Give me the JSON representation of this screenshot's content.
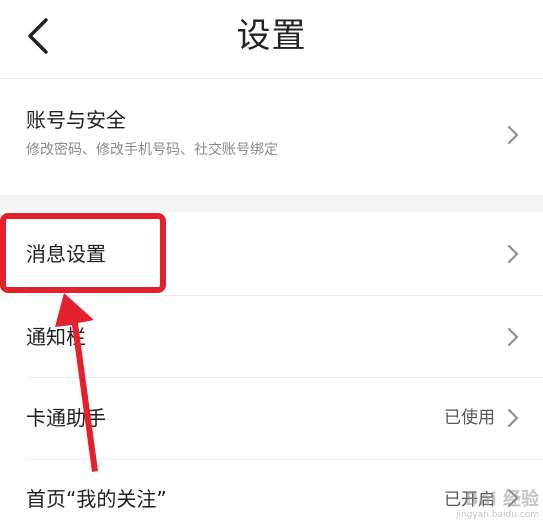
{
  "header": {
    "title": "设置"
  },
  "rows": [
    {
      "title": "账号与安全",
      "subtitle": "修改密码、修改手机号码、社交账号绑定",
      "value": ""
    },
    {
      "title": "消息设置",
      "subtitle": "",
      "value": ""
    },
    {
      "title": "通知栏",
      "subtitle": "",
      "value": ""
    },
    {
      "title": "卡通助手",
      "subtitle": "",
      "value": "已使用"
    },
    {
      "title": "首页“我的关注”",
      "subtitle": "",
      "value": "已开启"
    }
  ],
  "annotation": {
    "highlight_color": "#e3202b",
    "highlighted_item": "消息设置"
  },
  "watermark": {
    "logo": "Bai 经验",
    "url": "jingyan.baidu.com"
  },
  "icons": {
    "back": "chevron-left-icon",
    "row_arrow": "chevron-right-icon"
  }
}
